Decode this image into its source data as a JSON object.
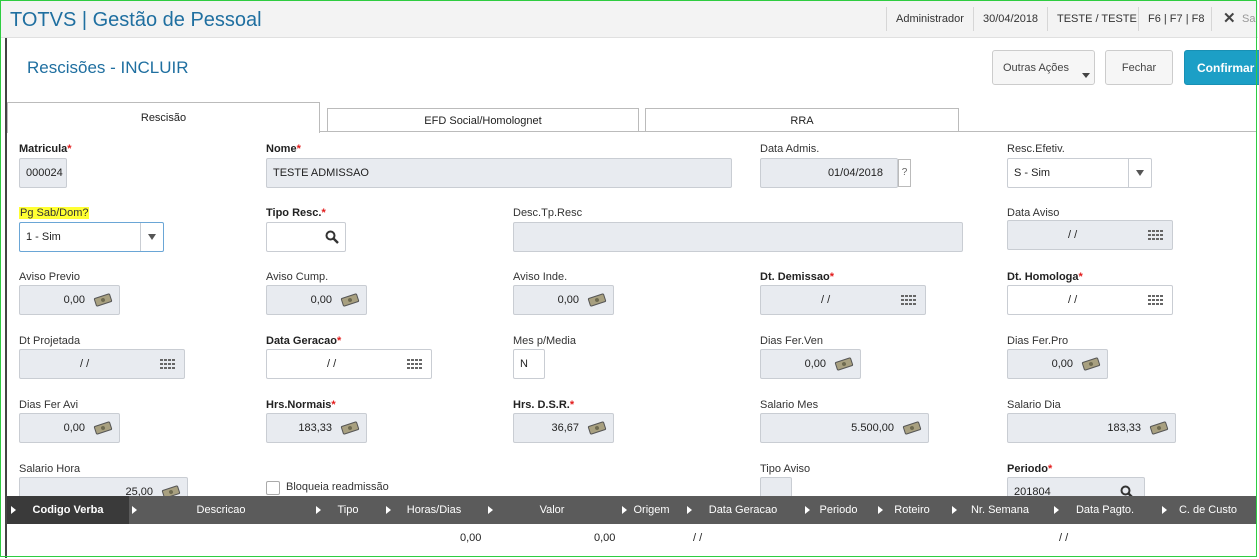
{
  "topbar": {
    "app_title": "TOTVS | Gestão de Pessoal",
    "user": "Administrador",
    "date": "30/04/2018",
    "company": "TESTE / TESTE",
    "shortcuts": "F6 | F7 | F8",
    "exit_label": "Sa"
  },
  "header": {
    "page_title": "Rescisões - INCLUIR",
    "other_actions": "Outras Ações",
    "close": "Fechar",
    "confirm": "Confirmar"
  },
  "tabs": [
    "Rescisão",
    "EFD Social/Homolognet",
    "RRA"
  ],
  "form": {
    "matricula": {
      "label": "Matricula",
      "value": "000024"
    },
    "nome": {
      "label": "Nome",
      "value": "TESTE ADMISSAO"
    },
    "data_admis": {
      "label": "Data Admis.",
      "value": "01/04/2018",
      "help": "?"
    },
    "resc_efetiv": {
      "label": "Resc.Efetiv.",
      "value": "S - Sim"
    },
    "pg_sab_dom": {
      "label": "Pg Sab/Dom?",
      "value": "1 - Sim"
    },
    "tipo_resc": {
      "label": "Tipo Resc.",
      "value": ""
    },
    "desc_tp_resc": {
      "label": "Desc.Tp.Resc",
      "value": ""
    },
    "data_aviso": {
      "label": "Data Aviso",
      "value": "/ /"
    },
    "aviso_previo": {
      "label": "Aviso Previo",
      "value": "0,00"
    },
    "aviso_cump": {
      "label": "Aviso Cump.",
      "value": "0,00"
    },
    "aviso_inde": {
      "label": "Aviso Inde.",
      "value": "0,00"
    },
    "dt_demissao": {
      "label": "Dt. Demissao",
      "value": "/ /"
    },
    "dt_homologa": {
      "label": "Dt. Homologa",
      "value": "/ /"
    },
    "dt_projetada": {
      "label": "Dt Projetada",
      "value": "/ /"
    },
    "data_geracao": {
      "label": "Data Geracao",
      "value": "/ /"
    },
    "mes_media": {
      "label": "Mes p/Media",
      "value": "N"
    },
    "dias_fer_ven": {
      "label": "Dias Fer.Ven",
      "value": "0,00"
    },
    "dias_fer_pro": {
      "label": "Dias Fer.Pro",
      "value": "0,00"
    },
    "dias_fer_avi": {
      "label": "Dias Fer Avi",
      "value": "0,00"
    },
    "hrs_normais": {
      "label": "Hrs.Normais",
      "value": "183,33"
    },
    "hrs_dsr": {
      "label": "Hrs. D.S.R.",
      "value": "36,67"
    },
    "salario_mes": {
      "label": "Salario Mes",
      "value": "5.500,00"
    },
    "salario_dia": {
      "label": "Salario Dia",
      "value": "183,33"
    },
    "salario_hora": {
      "label": "Salario Hora",
      "value": "25,00"
    },
    "bloqueia": {
      "label": "Bloqueia readmissão"
    },
    "tipo_aviso": {
      "label": "Tipo Aviso",
      "value": ""
    },
    "periodo": {
      "label": "Periodo",
      "value": "201804"
    },
    "required_mark": "*"
  },
  "grid": {
    "columns": [
      "Codigo Verba",
      "Descricao",
      "Tipo",
      "Horas/Dias",
      "Valor",
      "Origem",
      "Data Geracao",
      "Periodo",
      "Roteiro",
      "Nr. Semana",
      "Data Pagto.",
      "C. de Custo"
    ],
    "row": {
      "horas": "0,00",
      "valor": "0,00",
      "data_geracao": "/ /",
      "data_pagto": "/ /"
    }
  },
  "colors": {
    "accent": "#1f6fa0",
    "confirm": "#1c9fc6",
    "required": "#e21b1b",
    "highlight": "#ffff33"
  }
}
